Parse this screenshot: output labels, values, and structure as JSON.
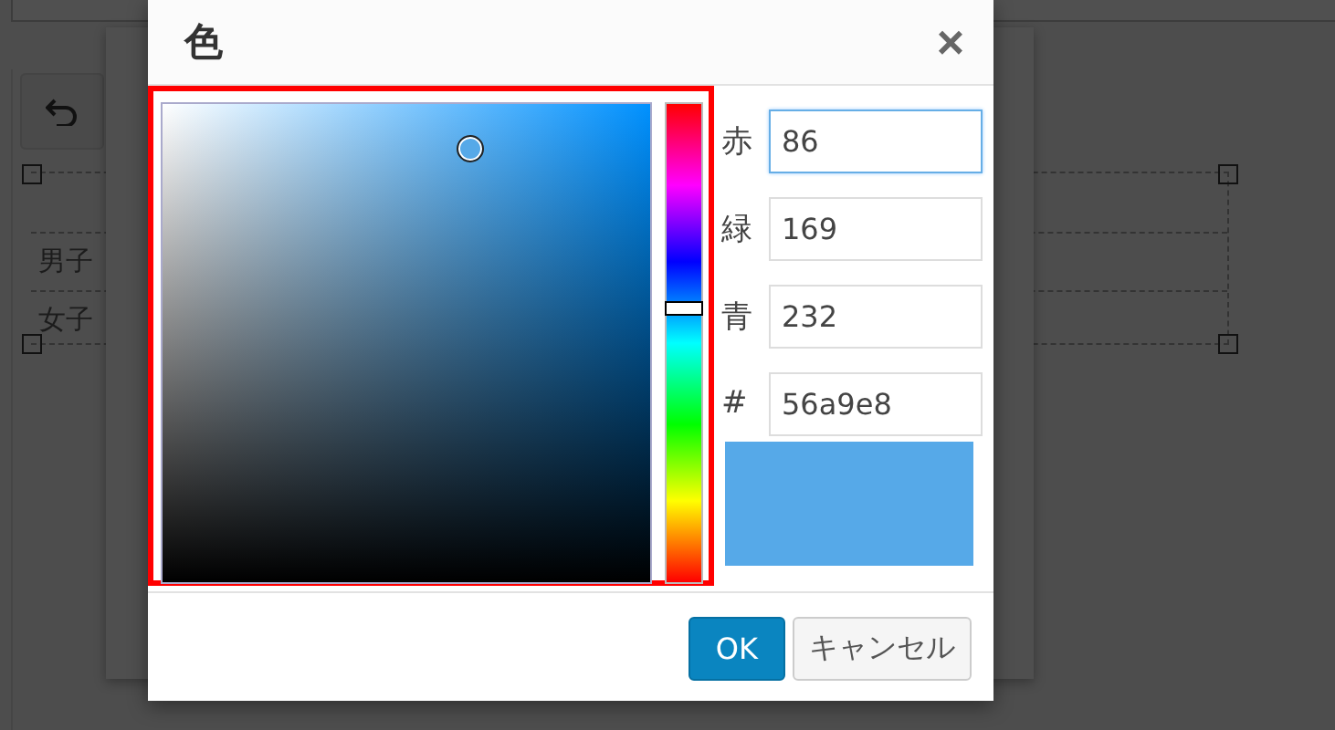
{
  "background": {
    "rows": [
      {
        "label": "男子"
      },
      {
        "label": "女子"
      }
    ]
  },
  "dialog": {
    "title": "色",
    "close": "×",
    "fields": [
      {
        "label": "赤",
        "value": "86",
        "focused": true
      },
      {
        "label": "緑",
        "value": "169",
        "focused": false
      },
      {
        "label": "青",
        "value": "232",
        "focused": false
      },
      {
        "label": "#",
        "value": "56a9e8",
        "focused": false
      }
    ],
    "buttons": [
      {
        "label": "OK",
        "kind": "primary"
      },
      {
        "label": "キャンセル",
        "kind": "default"
      }
    ]
  }
}
